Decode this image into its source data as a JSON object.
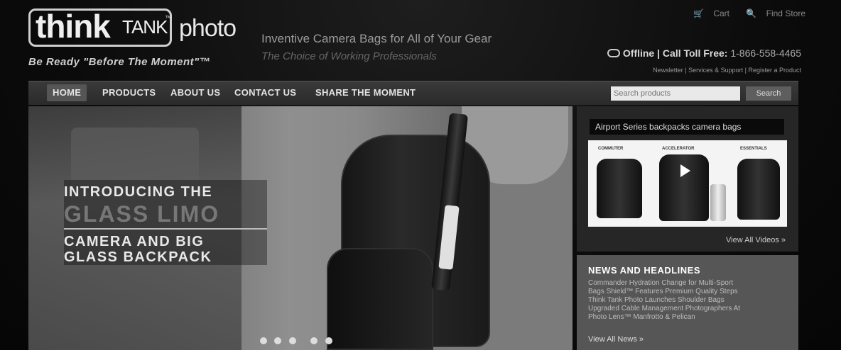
{
  "logo": {
    "think": "think",
    "tank": "TANK",
    "tm": "™",
    "photo": "photo",
    "slogan": "Be Ready \"Before The Moment\"™"
  },
  "taglines": {
    "line1": "Inventive Camera Bags for All of Your Gear",
    "line2": "The Choice of Working Professionals"
  },
  "top_links": {
    "cart": "Cart",
    "find_store": "Find Store"
  },
  "contact": {
    "status": "Offline",
    "call": "| Call Toll Free:",
    "phone": "1-866-558-4465",
    "sub_links": "Newsletter | Services & Support | Register a Product"
  },
  "nav": {
    "home": "HOME",
    "products": "PRODUCTS",
    "about": "ABOUT US",
    "contact": "CONTACT US",
    "share": "SHARE THE MOMENT",
    "search_placeholder": "Search products",
    "search_button": "Search"
  },
  "hero": {
    "line1": "INTRODUCING THE",
    "line2": "GLASS LIMO",
    "line3": "CAMERA AND BIG",
    "line4": "GLASS BACKPACK",
    "slides": 5
  },
  "video": {
    "title": "Airport Series backpacks camera bags",
    "labels": [
      "COMMUTER",
      "ACCELERATOR",
      "ESSENTIALS"
    ],
    "view_all": "View All Videos »"
  },
  "news": {
    "title": "NEWS AND HEADLINES",
    "body": "Commander Hydration Change for Multi-Sport Bags Shield™ Features Premium Quality Steps Think Tank Photo Launches Shoulder Bags Upgraded Cable Management Photographers At Photo Lens™ Manfrotto & Pelican",
    "view_all": "View All News »"
  }
}
